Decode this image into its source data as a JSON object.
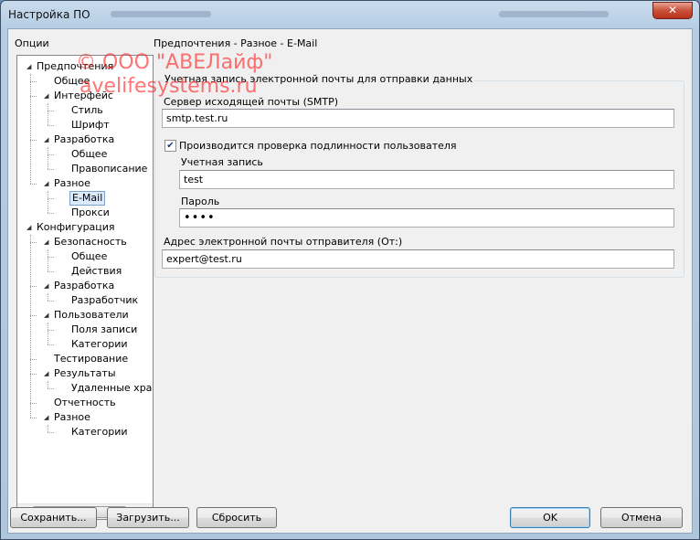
{
  "window": {
    "title": "Настройка ПО",
    "close_label": "✕"
  },
  "options_label": "Опции",
  "breadcrumb": "Предпочтения - Разное - E-Mail",
  "tree": [
    {
      "label": "Предпочтения",
      "level": 0,
      "expanded": true
    },
    {
      "label": "Общее",
      "level": 1
    },
    {
      "label": "Интерфейс",
      "level": 1,
      "expanded": true
    },
    {
      "label": "Стиль",
      "level": 2
    },
    {
      "label": "Шрифт",
      "level": 2
    },
    {
      "label": "Разработка",
      "level": 1,
      "expanded": true
    },
    {
      "label": "Общее",
      "level": 2
    },
    {
      "label": "Правописание",
      "level": 2
    },
    {
      "label": "Разное",
      "level": 1,
      "expanded": true
    },
    {
      "label": "E-Mail",
      "level": 2,
      "selected": true
    },
    {
      "label": "Прокси",
      "level": 2
    },
    {
      "label": "Конфигурация",
      "level": 0,
      "expanded": true
    },
    {
      "label": "Безопасность",
      "level": 1,
      "expanded": true
    },
    {
      "label": "Общее",
      "level": 2
    },
    {
      "label": "Действия",
      "level": 2
    },
    {
      "label": "Разработка",
      "level": 1,
      "expanded": true
    },
    {
      "label": "Разработчик",
      "level": 2
    },
    {
      "label": "Пользователи",
      "level": 1,
      "expanded": true
    },
    {
      "label": "Поля записи",
      "level": 2
    },
    {
      "label": "Категории",
      "level": 2
    },
    {
      "label": "Тестирование",
      "level": 1
    },
    {
      "label": "Результаты",
      "level": 1,
      "expanded": true
    },
    {
      "label": "Удаленные хра",
      "level": 2
    },
    {
      "label": "Отчетность",
      "level": 1
    },
    {
      "label": "Разное",
      "level": 1,
      "expanded": true
    },
    {
      "label": "Категории",
      "level": 2
    }
  ],
  "email": {
    "group_title": "Учетная запись электронной почты для отправки данных",
    "smtp_label": "Сервер исходящей почты (SMTP)",
    "smtp_value": "smtp.test.ru",
    "auth_label": "Производится проверка подлинности пользователя",
    "auth_checked": true,
    "account_label": "Учетная запись",
    "account_value": "test",
    "password_label": "Пароль",
    "password_value": "••••",
    "from_label": "Адрес электронной почты отправителя (От:)",
    "from_value": "expert@test.ru"
  },
  "buttons": {
    "save": "Сохранить...",
    "load": "Загрузить...",
    "reset": "Сбросить",
    "ok": "OK",
    "cancel": "Отмена"
  },
  "watermark": {
    "line1": "© ООО \"АВЕЛайф\"",
    "line2": "avelifesystems.ru",
    "color": "#ff2a2a"
  },
  "colors": {
    "selected_bg": "#dcebfc",
    "checkmark": "#1a3e72"
  }
}
